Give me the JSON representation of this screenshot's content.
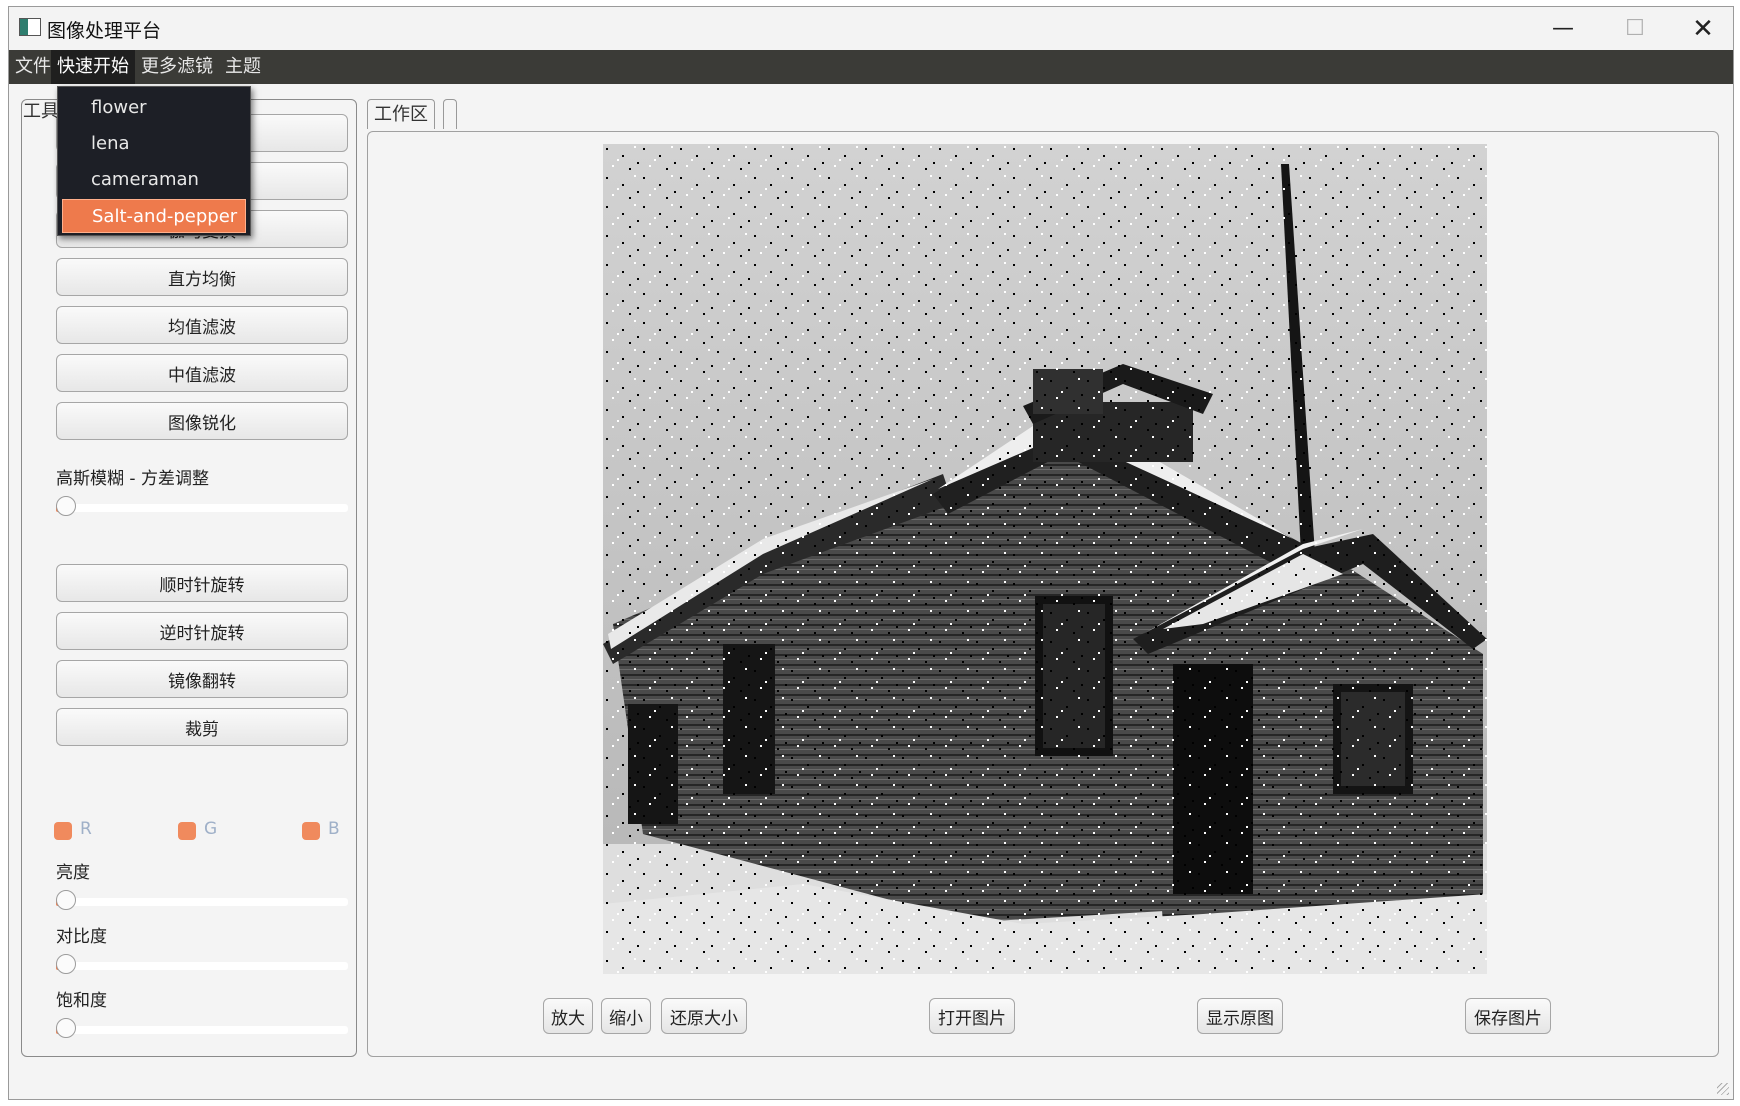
{
  "window": {
    "title": "图像处理平台",
    "controls": {
      "minimize": "—",
      "maximize": "☐",
      "close": "✕"
    }
  },
  "menubar": {
    "items": [
      "文件",
      "快速开始",
      "更多滤镜",
      "主题"
    ],
    "open_index": 1
  },
  "quick_start_menu": {
    "items": [
      "flower",
      "lena",
      "cameraman",
      "Salt-and-pepper"
    ],
    "highlighted": "Salt-and-pepper"
  },
  "tools_panel": {
    "tab_label": "工具",
    "buttons_top": [
      "",
      "",
      "伽马变换",
      "直方均衡",
      "均值滤波",
      "中值滤波",
      "图像锐化"
    ],
    "gaussian_label": "高斯模糊 - 方差调整",
    "gaussian_value": 0,
    "buttons_transform": [
      "顺时针旋转",
      "逆时针旋转",
      "镜像翻转",
      "裁剪"
    ],
    "channels": [
      "R",
      "G",
      "B"
    ],
    "brightness_label": "亮度",
    "brightness_value": 0,
    "contrast_label": "对比度",
    "contrast_value": 0,
    "saturation_label": "饱和度",
    "saturation_value": 0
  },
  "workspace": {
    "tab_label": "工作区",
    "image_description": "",
    "buttons": {
      "zoom_in": "放大",
      "zoom_out": "缩小",
      "reset_size": "还原大小",
      "open_image": "打开图片",
      "show_original": "显示原图",
      "save_image": "保存图片"
    }
  },
  "colors": {
    "accent": "#ee7a4c",
    "menubar_bg": "#3b3b37",
    "dropdown_bg": "#1d1f26"
  }
}
